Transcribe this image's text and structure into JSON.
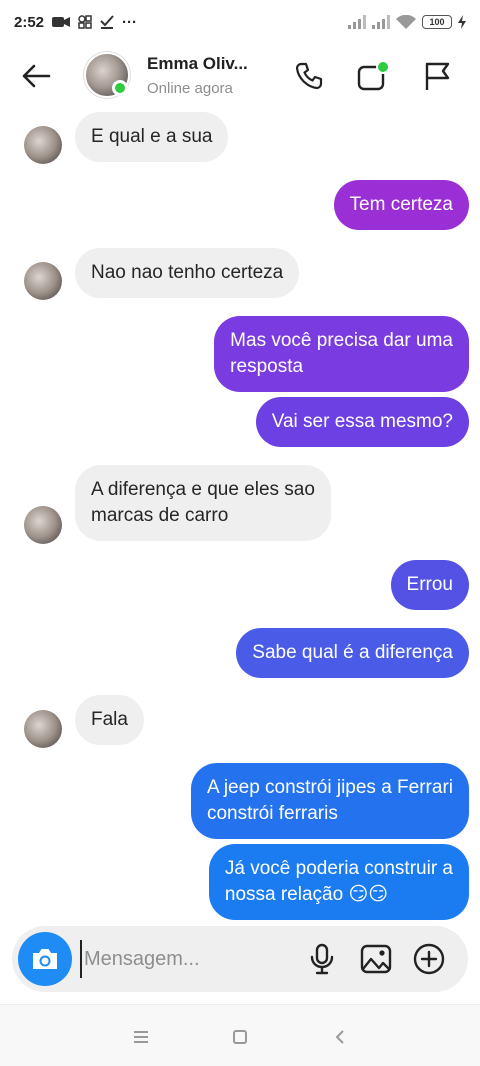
{
  "status_bar": {
    "time": "2:52",
    "more": "···",
    "battery": "100",
    "icons": [
      "video-camera-icon",
      "app-grid-icon",
      "download-done-icon",
      "signal-icon",
      "signal-icon",
      "wifi-icon",
      "battery-icon",
      "charging-icon"
    ]
  },
  "header": {
    "contact_name": "Emma Oliv...",
    "contact_status": "Online agora",
    "icons": [
      "back-arrow-icon",
      "phone-icon",
      "video-call-icon",
      "flag-icon"
    ]
  },
  "messages": [
    {
      "direction": "in",
      "lines": [
        "E qual e a sua"
      ],
      "show_avatar": true
    },
    {
      "direction": "out",
      "lines": [
        "Tem certeza"
      ],
      "color": "#9b2fd6"
    },
    {
      "direction": "in",
      "lines": [
        "Nao nao tenho certeza"
      ],
      "show_avatar": true
    },
    {
      "direction": "out",
      "lines": [
        "Mas você precisa dar uma",
        "resposta"
      ],
      "color": "#7a3be0"
    },
    {
      "direction": "out",
      "lines": [
        "Vai ser essa mesmo?"
      ],
      "color": "#6c40e2"
    },
    {
      "direction": "in",
      "lines": [
        "A diferença e que eles sao",
        "marcas de carro"
      ],
      "show_avatar": true
    },
    {
      "direction": "out",
      "lines": [
        "Errou"
      ],
      "color": "#5452e4"
    },
    {
      "direction": "out",
      "lines": [
        "Sabe qual é a diferença"
      ],
      "color": "#4a5be8"
    },
    {
      "direction": "in",
      "lines": [
        "Fala"
      ],
      "show_avatar": true
    },
    {
      "direction": "out",
      "lines": [
        "A jeep constrói jipes a Ferrari",
        "constrói ferraris"
      ],
      "color": "#2572ee"
    },
    {
      "direction": "out",
      "lines": [
        "Já você poderia construir a",
        "nossa relação  😏😏"
      ],
      "color": "#1b7cf2"
    }
  ],
  "composer": {
    "placeholder": "Mensagem...",
    "icons": [
      "camera-icon",
      "microphone-icon",
      "image-icon",
      "plus-circle-icon"
    ]
  },
  "nav_bar": {
    "icons": [
      "recents-icon",
      "home-icon",
      "back-icon"
    ]
  },
  "colors": {
    "incoming_bubble": "#efefef",
    "camera_button": "#1f8cf5",
    "online": "#2ecc40"
  }
}
